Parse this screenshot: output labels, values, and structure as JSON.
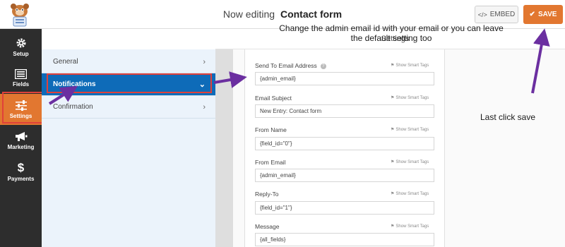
{
  "header": {
    "title_prefix": "Now editing",
    "form_name": "Contact form",
    "embed_label": "EMBED",
    "save_label": "SAVE"
  },
  "rail": {
    "items": [
      {
        "label": "Setup",
        "icon": "gear-icon"
      },
      {
        "label": "Fields",
        "icon": "list-icon"
      },
      {
        "label": "Settings",
        "icon": "sliders-icon",
        "active": true
      },
      {
        "label": "Marketing",
        "icon": "megaphone-icon"
      },
      {
        "label": "Payments",
        "icon": "dollar-icon"
      }
    ]
  },
  "panel": {
    "items": [
      {
        "label": "General",
        "chevron": "›"
      },
      {
        "label": "Notifications",
        "chevron": "⌄",
        "active": true
      },
      {
        "label": "Confirmation",
        "chevron": "›"
      }
    ]
  },
  "settings_title": "Settings",
  "smart_tags_label": "Show Smart Tags",
  "fields": [
    {
      "label": "Send To Email Address",
      "value": "{admin_email}",
      "help": "?"
    },
    {
      "label": "Email Subject",
      "value": "New Entry: Contact form"
    },
    {
      "label": "From Name",
      "value": "{field_id=\"0\"}"
    },
    {
      "label": "From Email",
      "value": "{admin_email}"
    },
    {
      "label": "Reply-To",
      "value": "{field_id=\"1\"}"
    },
    {
      "label": "Message",
      "value": "{all_fields}"
    }
  ],
  "annotations": {
    "top_note_line1": "Change the admin email id with your email or you can leave",
    "top_note_line2": "the default setting too",
    "save_note": "Last click save"
  },
  "colors": {
    "accent": "#e27730",
    "active_blue": "#0e6bb8",
    "rail_bg": "#2d2d2d",
    "highlight_red": "#e0413a",
    "arrow_purple": "#6b2fa0"
  }
}
